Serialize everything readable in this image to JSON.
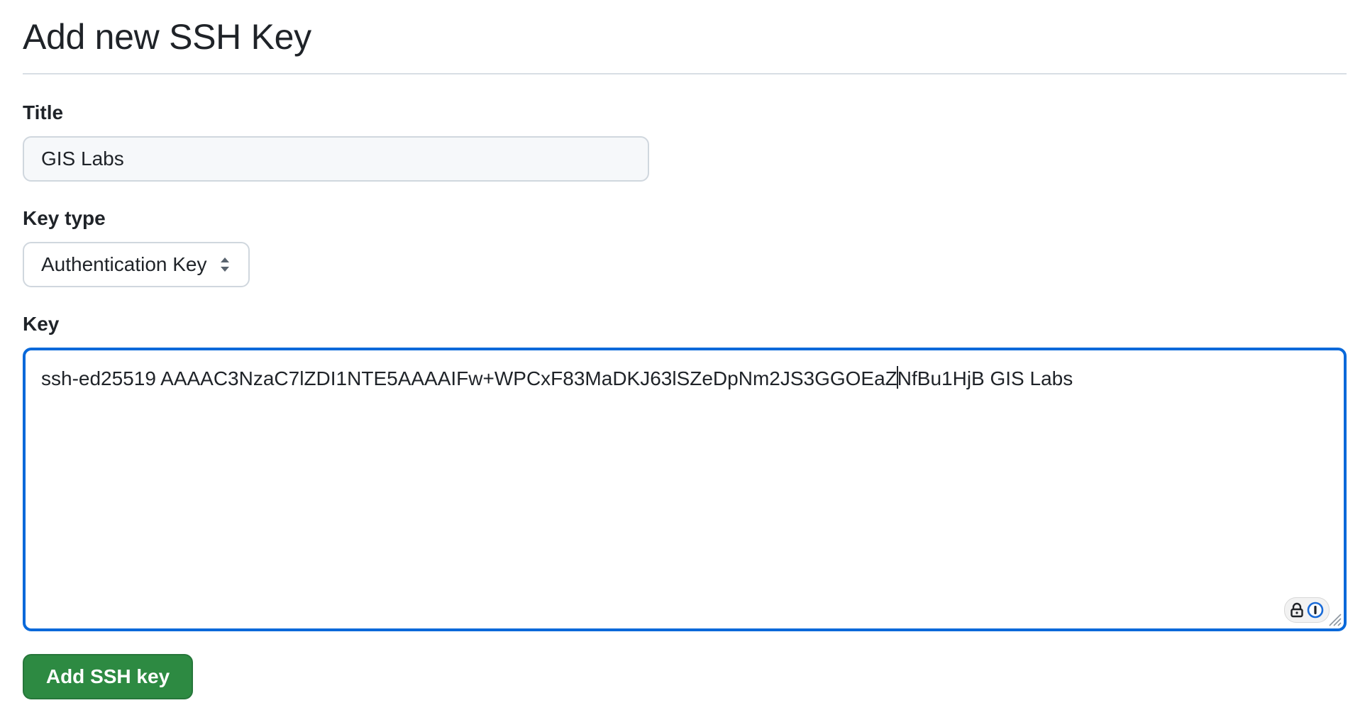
{
  "page": {
    "heading": "Add new SSH Key"
  },
  "form": {
    "title_label": "Title",
    "title_value": "GIS Labs",
    "key_type_label": "Key type",
    "key_type_selected": "Authentication Key",
    "key_label": "Key",
    "key_value_before_caret": "ssh-ed25519 AAAAC3NzaC7lZDI1NTE5AAAAIFw+WPCxF83MaDKJ63lSZeDpNm2JS3GGOEaZ",
    "key_value_after_caret": "NfBu1HjB GIS Labs",
    "submit_label": "Add SSH key"
  },
  "icons": {
    "key_type_select": "up-down-arrows-icon",
    "password_manager": "password-manager-icon",
    "resize": "resize-grip-icon"
  },
  "colors": {
    "focus_border": "#0969da",
    "button_bg": "#2d8a42",
    "input_bg": "#f6f8fa"
  }
}
